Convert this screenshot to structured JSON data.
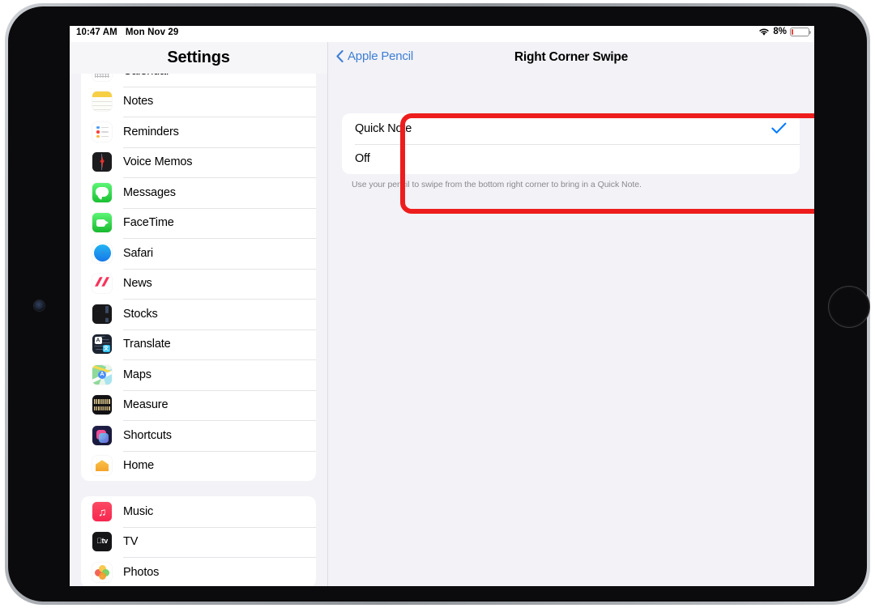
{
  "device": {
    "home_button": "home-button",
    "front_camera": "front-camera"
  },
  "status_bar": {
    "time": "10:47 AM",
    "date": "Mon Nov 29",
    "wifi_icon": "wifi-icon",
    "battery_percent": "8%",
    "battery_level": 8,
    "battery_color": "#ff3b30"
  },
  "sidebar": {
    "title": "Settings",
    "groups": [
      {
        "clipped_top": true,
        "items": [
          {
            "label": "Calendar",
            "icon": "calendar-icon"
          },
          {
            "label": "Notes",
            "icon": "notes-icon"
          },
          {
            "label": "Reminders",
            "icon": "reminders-icon"
          },
          {
            "label": "Voice Memos",
            "icon": "voice-memos-icon"
          },
          {
            "label": "Messages",
            "icon": "messages-icon"
          },
          {
            "label": "FaceTime",
            "icon": "facetime-icon"
          },
          {
            "label": "Safari",
            "icon": "safari-icon"
          },
          {
            "label": "News",
            "icon": "news-icon"
          },
          {
            "label": "Stocks",
            "icon": "stocks-icon"
          },
          {
            "label": "Translate",
            "icon": "translate-icon"
          },
          {
            "label": "Maps",
            "icon": "maps-icon"
          },
          {
            "label": "Measure",
            "icon": "measure-icon"
          },
          {
            "label": "Shortcuts",
            "icon": "shortcuts-icon"
          },
          {
            "label": "Home",
            "icon": "home-app-icon"
          }
        ]
      },
      {
        "clipped_top": false,
        "items": [
          {
            "label": "Music",
            "icon": "music-icon"
          },
          {
            "label": "TV",
            "icon": "tv-icon"
          },
          {
            "label": "Photos",
            "icon": "photos-icon"
          }
        ]
      }
    ]
  },
  "detail": {
    "back_label": "Apple Pencil",
    "back_icon": "chevron-left-icon",
    "title": "Right Corner Swipe",
    "accent_color": "#007aff",
    "options": [
      {
        "label": "Quick Note",
        "selected": true
      },
      {
        "label": "Off",
        "selected": false
      }
    ],
    "footnote": "Use your pencil to swipe from the bottom right corner to bring in a Quick Note.",
    "highlight_color": "#ee1d1d"
  }
}
